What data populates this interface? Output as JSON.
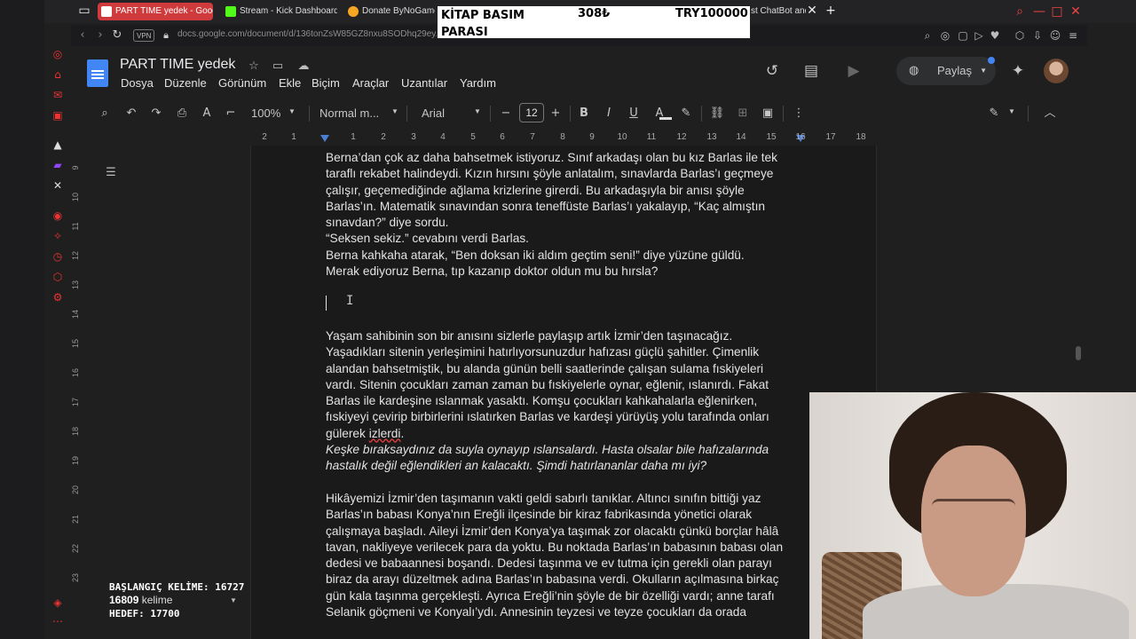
{
  "browser": {
    "tabs": [
      {
        "title": "PART TIME yedek - Goog",
        "active": true
      },
      {
        "title": "Stream - Kick Dashboard",
        "active": false
      },
      {
        "title": "Donate ByNoGame -",
        "active": false
      },
      {
        "title": "st ChatBot and",
        "active": false
      }
    ],
    "url": "docs.google.com/document/d/136tonZsW85GZ8nxu8SODhq29ey..."
  },
  "docs": {
    "title": "PART TIME yedek",
    "menu": [
      "Dosya",
      "Düzenle",
      "Görünüm",
      "Ekle",
      "Biçim",
      "Araçlar",
      "Uzantılar",
      "Yardım"
    ],
    "share_label": "Paylaş",
    "toolbar": {
      "zoom": "100%",
      "style": "Normal m...",
      "font": "Arial",
      "font_size": "12"
    },
    "ruler_top": [
      "2",
      "1",
      "1",
      "2",
      "3",
      "4",
      "5",
      "6",
      "7",
      "8",
      "9",
      "10",
      "11",
      "12",
      "13",
      "14",
      "15",
      "16",
      "17",
      "18"
    ],
    "ruler_left": [
      "9",
      "10",
      "11",
      "12",
      "13",
      "14",
      "15",
      "16",
      "17",
      "18",
      "19",
      "20",
      "21",
      "22",
      "23"
    ]
  },
  "content": {
    "block1": [
      "Berna’dan çok az daha bahsetmek istiyoruz. Sınıf arkadaşı olan bu kız Barlas ile tek",
      "taraflı rekabet halindeydi. Kızın hırsını şöyle anlatalım, sınavlarda Barlas’ı geçmeye",
      "çalışır, geçemediğinde ağlama krizlerine girerdi. Bu arkadaşıyla bir anısı şöyle",
      "Barlas’ın. Matematik sınavından sonra teneffüste Barlas’ı yakalayıp, “Kaç almıştın",
      "sınavdan?” diye sordu.",
      "“Seksen sekiz.” cevabını verdi Barlas.",
      "Berna kahkaha atarak, “Ben doksan iki aldım geçtim seni!” diye yüzüne güldü.",
      "Merak ediyoruz Berna, tıp kazanıp doktor oldun mu bu hırsla?"
    ],
    "block2": [
      "Yaşam sahibinin son bir anısını sizlerle paylaşıp artık İzmir’den taşınacağız.",
      "Yaşadıkları sitenin yerleşimini hatırlıyorsunuzdur hafızası güçlü şahitler. Çimenlik",
      "alandan bahsetmiştik, bu alanda günün belli saatlerinde çalışan sulama fıskiyeleri",
      "vardı. Sitenin çocukları zaman zaman bu fıskiyelerle oynar, eğlenir, ıslanırdı. Fakat",
      "Barlas ile kardeşine ıslanmak yasaktı. Komşu çocukları kahkahalarla eğlenirken,",
      "fıskiyeyi çevirip birbirlerini ıslatırken Barlas ve kardeşi yürüyüş yolu tarafında onları"
    ],
    "block2_last_prefix": "gülerek ",
    "block2_last_word": "izlerdi",
    "block2_last_suffix": ".",
    "italic": [
      "Keşke bıraksaydınız da suyla oynayıp ıslansalardı. Hasta olsalar bile hafızalarında",
      "hastalık değil eğlendikleri an kalacaktı. Şimdi hatırlananlar daha mı iyi?"
    ],
    "block3": [
      "Hikâyemizi İzmir’den taşımanın vakti geldi sabırlı tanıklar. Altıncı sınıfın bittiği yaz",
      "Barlas’ın babası Konya’nın Ereğli ilçesinde bir kiraz fabrikasında yönetici olarak",
      "çalışmaya başladı. Aileyi İzmir’den Konya’ya taşımak zor olacaktı çünkü borçlar hâlâ",
      "tavan, nakliyeye verilecek para da yoktu. Bu noktada Barlas’ın babasının babası olan",
      "dedesi ve babaannesi boşandı. Dedesi taşınma ve ev tutma için gerekli olan parayı",
      "biraz da arayı düzeltmek adına Barlas’ın babasına verdi. Okulların açılmasına birkaç",
      "gün kala taşınma gerçekleşti. Ayrıca Ereğli’nin şöyle de bir özelliği vardı; anne tarafı",
      "Selanik göçmeni ve Konyalı’ydı. Annesinin teyzesi ve teyze çocukları da orada"
    ]
  },
  "overlay": {
    "kitap_label": "KİTAP BASIM PARASI",
    "kitap_current": "308₺",
    "kitap_target": "TRY100000",
    "start_words": "BAŞLANGIÇ KELİME: 16727",
    "word_count": "16809",
    "word_suffix": " kelime",
    "goal": "HEDEF: 17700"
  },
  "colors": {
    "accent_tab": "#cf3a3d",
    "docs_blue": "#4285f4",
    "background": "#1f1f1f"
  }
}
